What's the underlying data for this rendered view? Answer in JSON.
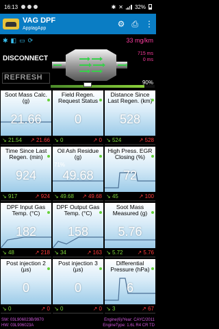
{
  "status": {
    "time": "16:13",
    "battery": "32%"
  },
  "app": {
    "title": "VAG DPF",
    "subtitle": "ApplagApp"
  },
  "top": {
    "rate": "33 mg/km",
    "disconnect": "DISCONNECT",
    "refresh": "REFRESH",
    "side1": "715 ms",
    "side2": "0 ms",
    "percent": "90%",
    "progress_fraction": 0.9
  },
  "tiles": [
    {
      "label": "Soot Mass Calc. (g)",
      "value": "21.66",
      "min": "21.54",
      "max": "21.66"
    },
    {
      "label": "Field Regen. Request Status",
      "value": "0",
      "min": "0",
      "max": "0"
    },
    {
      "label": "Distance Since Last Regen. (km)",
      "value": "528",
      "min": "524",
      "max": "528"
    },
    {
      "label": "Time Since Last Regen. (min)",
      "value": "924",
      "min": "917",
      "max": "924"
    },
    {
      "label": "Oil Ash Residue (g)",
      "value": "49.68",
      "min": "49.68",
      "max": "49.68",
      "extra": "71%"
    },
    {
      "label": "High Press. EGR Closing (%)",
      "value": "72",
      "min": "45",
      "max": "100"
    },
    {
      "label": "DPF Input Gas Temp. (°C)",
      "value": "182",
      "min": "48",
      "max": "218"
    },
    {
      "label": "DPF Output Gas Temp. (°C)",
      "value": "158",
      "min": "34",
      "max": "163"
    },
    {
      "label": "Soot Mass Measured (g)",
      "value": "5.76",
      "min": "5.72",
      "max": "5.76"
    },
    {
      "label": "Post injection 2 (µs)",
      "value": "0",
      "min": "0",
      "max": "0"
    },
    {
      "label": "Post injection 3 (µs)",
      "value": "0",
      "min": "0",
      "max": "0"
    },
    {
      "label": "Differential Pressure (hPa)",
      "value": "6",
      "min": "3",
      "max": "67"
    }
  ],
  "footer": {
    "left1": "SW: 03L906023B/9970",
    "left2": "HW: 03L906023A",
    "right1": "Engine(6)/Year: CAYC/2011",
    "right2": "EngineType: 1.6L R4 CR TD"
  },
  "colors": {
    "appbar": "#0a7dc4",
    "min": "#7ed43a",
    "max": "#ff3b3b",
    "accent": "#ff3da0"
  }
}
